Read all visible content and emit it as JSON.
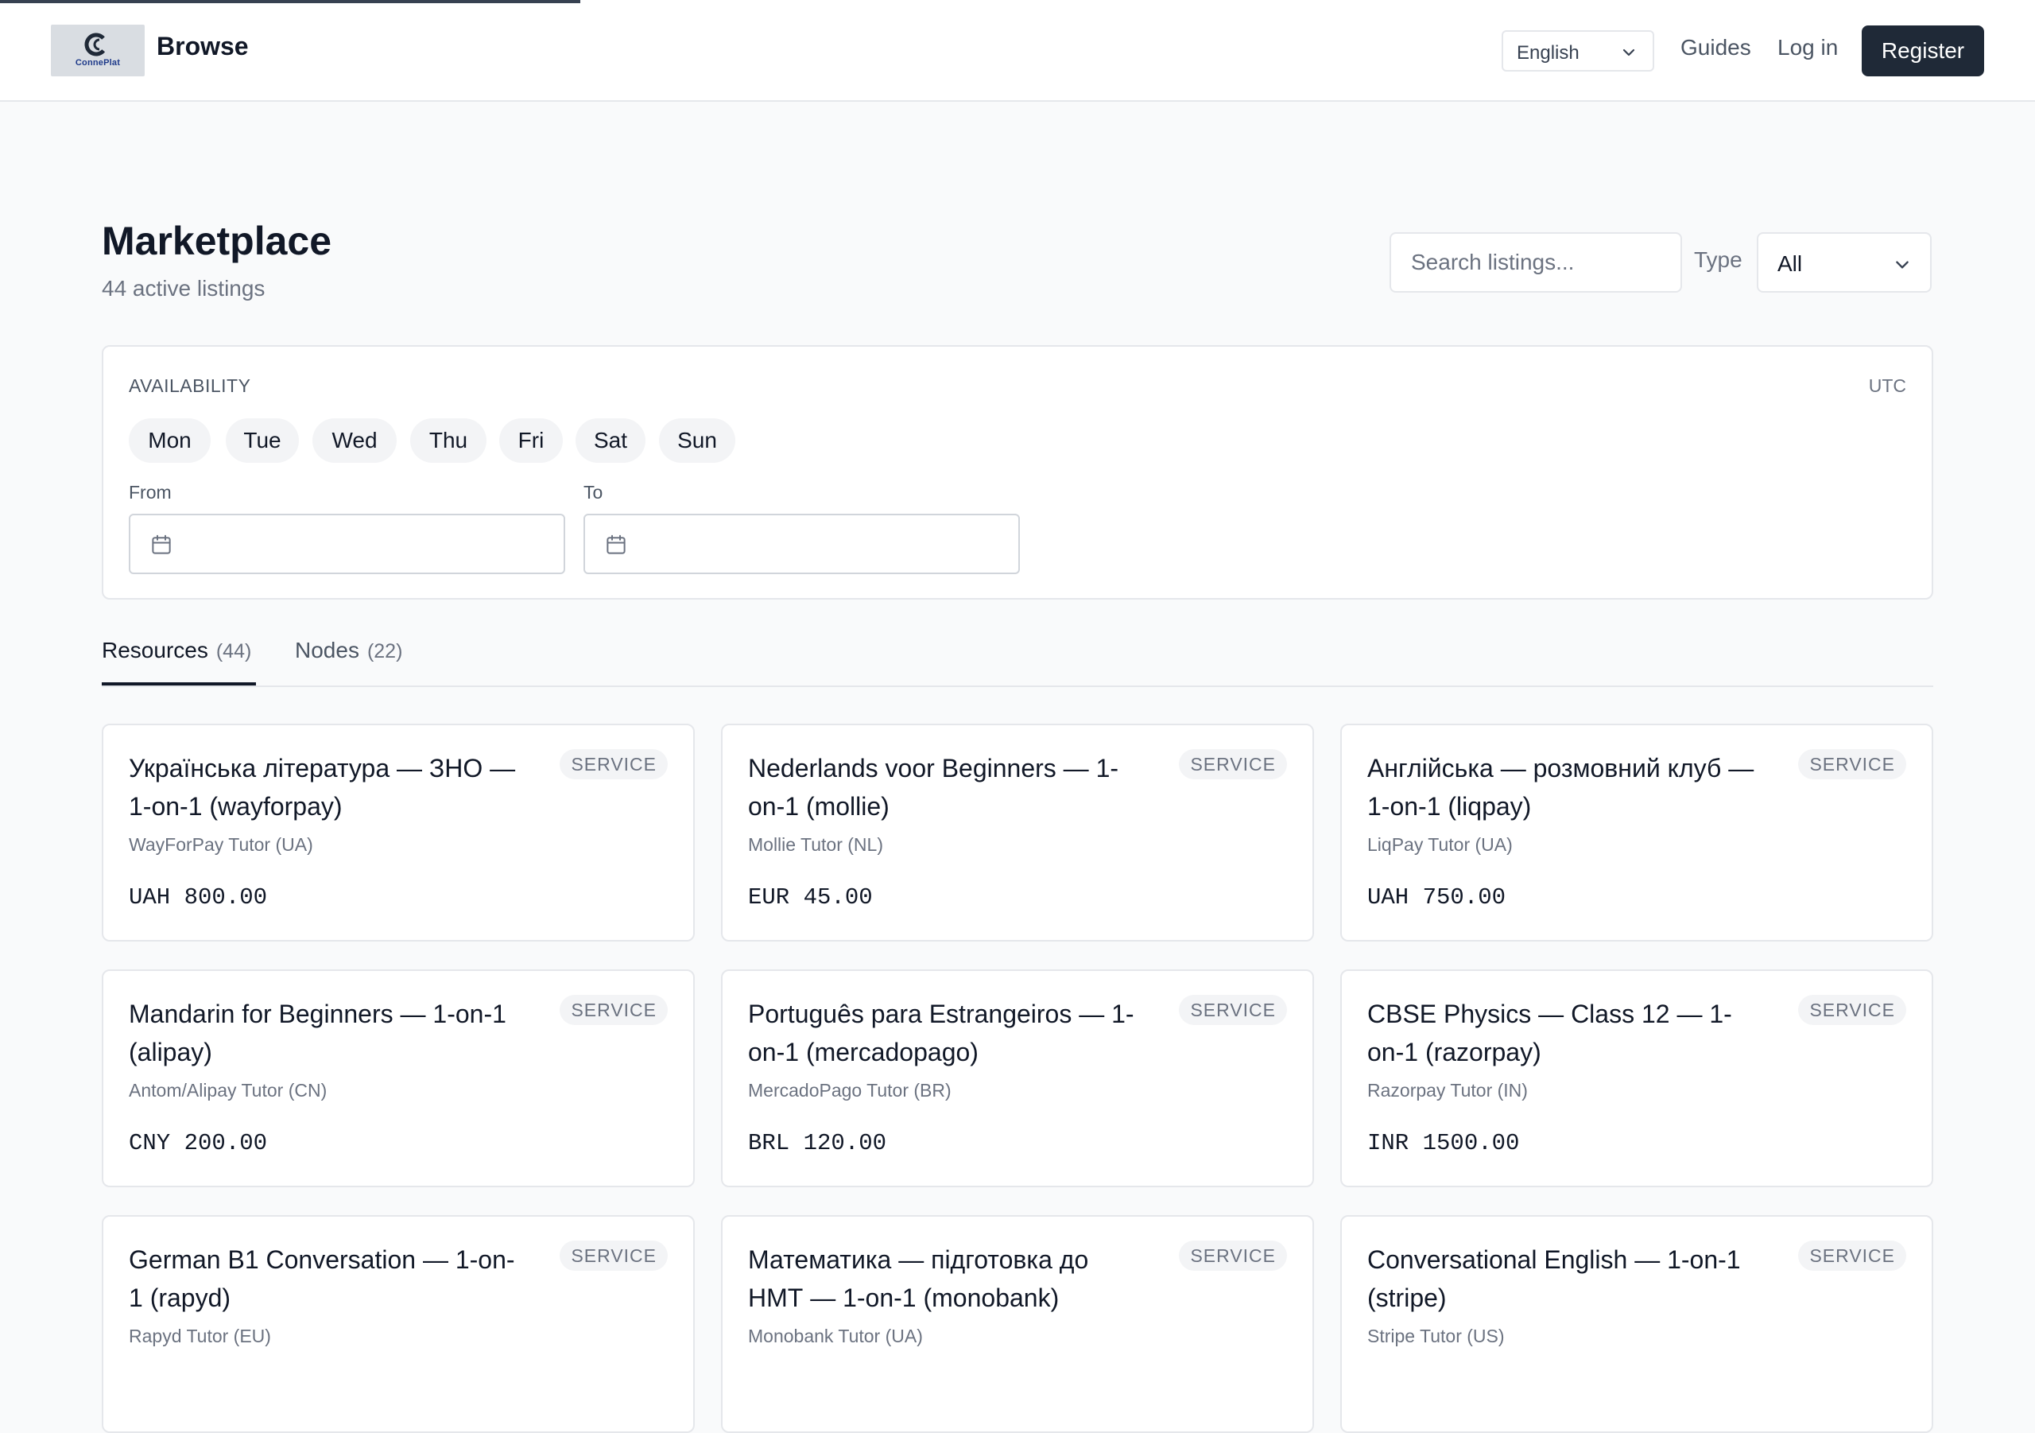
{
  "header": {
    "logo_text": "ConnePlat",
    "brand": "Browse",
    "language": "English",
    "guides": "Guides",
    "login": "Log in",
    "register": "Register"
  },
  "page": {
    "title": "Marketplace",
    "subtitle": "44 active listings",
    "search_placeholder": "Search listings...",
    "type_label": "Type",
    "type_value": "All"
  },
  "availability": {
    "title": "AVAILABILITY",
    "timezone": "UTC",
    "days": [
      "Mon",
      "Tue",
      "Wed",
      "Thu",
      "Fri",
      "Sat",
      "Sun"
    ],
    "from_label": "From",
    "to_label": "To"
  },
  "tabs": [
    {
      "label": "Resources",
      "count": "(44)"
    },
    {
      "label": "Nodes",
      "count": "(22)"
    }
  ],
  "listings": [
    {
      "title": "Українська література — ЗНО — 1-on-1 (wayforpay)",
      "badge": "SERVICE",
      "provider": "WayForPay Tutor (UA)",
      "price": "UAH 800.00"
    },
    {
      "title": "Nederlands voor Beginners — 1-on-1 (mollie)",
      "badge": "SERVICE",
      "provider": "Mollie Tutor (NL)",
      "price": "EUR 45.00"
    },
    {
      "title": "Англійська — розмовний клуб — 1-on-1 (liqpay)",
      "badge": "SERVICE",
      "provider": "LiqPay Tutor (UA)",
      "price": "UAH 750.00"
    },
    {
      "title": "Mandarin for Beginners — 1-on-1 (alipay)",
      "badge": "SERVICE",
      "provider": "Antom/Alipay Tutor (CN)",
      "price": "CNY 200.00"
    },
    {
      "title": "Português para Estrangeiros — 1-on-1 (mercadopago)",
      "badge": "SERVICE",
      "provider": "MercadoPago Tutor (BR)",
      "price": "BRL 120.00"
    },
    {
      "title": "CBSE Physics — Class 12 — 1-on-1 (razorpay)",
      "badge": "SERVICE",
      "provider": "Razorpay Tutor (IN)",
      "price": "INR 1500.00"
    },
    {
      "title": "German B1 Conversation — 1-on-1 (rapyd)",
      "badge": "SERVICE",
      "provider": "Rapyd Tutor (EU)",
      "price": ""
    },
    {
      "title": "Математика — підготовка до НМТ — 1-on-1 (monobank)",
      "badge": "SERVICE",
      "provider": "Monobank Tutor (UA)",
      "price": ""
    },
    {
      "title": "Conversational English — 1-on-1 (stripe)",
      "badge": "SERVICE",
      "provider": "Stripe Tutor (US)",
      "price": ""
    }
  ]
}
